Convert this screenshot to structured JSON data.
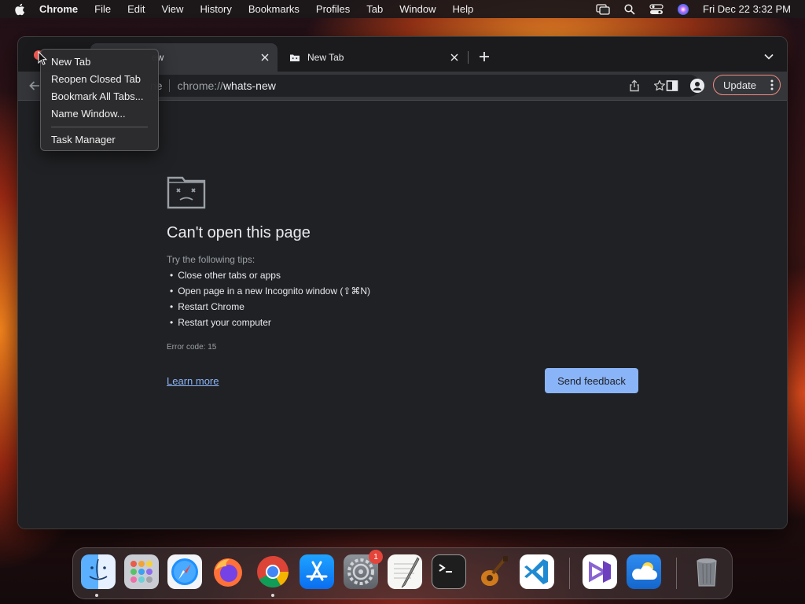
{
  "menubar": {
    "app_name": "Chrome",
    "items": [
      "File",
      "Edit",
      "View",
      "History",
      "Bookmarks",
      "Profiles",
      "Tab",
      "Window",
      "Help"
    ],
    "clock": "Fri Dec 22  3:32 PM"
  },
  "tabs": [
    {
      "title": "What's New",
      "visible_title": "ew",
      "active": true
    },
    {
      "title": "New Tab",
      "active": false
    }
  ],
  "omnibox": {
    "site_chip": "Chrome",
    "visible_chip": "ne",
    "url_scheme": "chrome://",
    "url_path": "whats-new"
  },
  "toolbar": {
    "update_label": "Update"
  },
  "context_menu": {
    "items": [
      "New Tab",
      "Reopen Closed Tab",
      "Bookmark All Tabs...",
      "Name Window..."
    ],
    "items_after_separator": [
      "Task Manager"
    ]
  },
  "error_page": {
    "title": "Can't open this page",
    "tips_label": "Try the following tips:",
    "tips": [
      "Close other tabs or apps",
      "Open page in a new Incognito window (⇧⌘N)",
      "Restart Chrome",
      "Restart your computer"
    ],
    "error_code": "Error code: 15",
    "learn_more": "Learn more",
    "feedback_button": "Send feedback"
  },
  "dock": {
    "apps": [
      {
        "name": "Finder",
        "icon": "finder-icon",
        "running": true
      },
      {
        "name": "Launchpad",
        "icon": "launchpad-icon",
        "running": false
      },
      {
        "name": "Safari",
        "icon": "safari-icon",
        "running": false
      },
      {
        "name": "Firefox",
        "icon": "firefox-icon",
        "running": false
      },
      {
        "name": "Google Chrome",
        "icon": "chrome-icon",
        "running": true
      },
      {
        "name": "App Store",
        "icon": "app-store-icon",
        "running": false
      },
      {
        "name": "System Settings",
        "icon": "system-settings-icon",
        "running": false,
        "badge": "1"
      },
      {
        "name": "TextEdit",
        "icon": "textedit-icon",
        "running": false
      },
      {
        "name": "Terminal",
        "icon": "terminal-icon",
        "running": false
      },
      {
        "name": "GarageBand",
        "icon": "garageband-icon",
        "running": false
      },
      {
        "name": "Visual Studio Code",
        "icon": "vscode-icon",
        "running": false
      },
      {
        "name": "Visual Studio",
        "icon": "visual-studio-icon",
        "running": false
      },
      {
        "name": "Weather",
        "icon": "weather-icon",
        "running": false
      },
      {
        "name": "Trash",
        "icon": "trash-icon",
        "running": false
      }
    ]
  },
  "colors": {
    "accent_blue": "#8ab4f8",
    "window_bg": "#202124",
    "toolbar_bg": "#35363a",
    "update_border": "#f28b82",
    "close_red": "#ff5f57"
  }
}
